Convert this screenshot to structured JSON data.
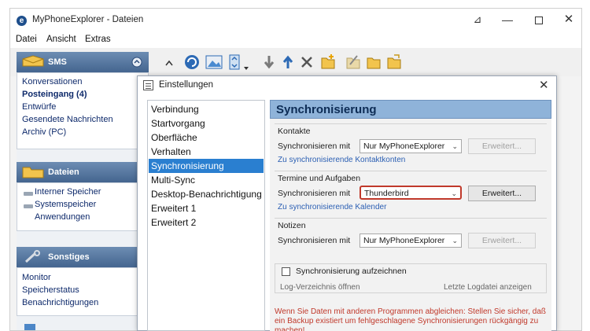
{
  "window": {
    "title": "MyPhoneExplorer - Dateien",
    "controls": {
      "pin": "⊿",
      "minimize": "—",
      "close": "✕"
    }
  },
  "menubar": [
    "Datei",
    "Ansicht",
    "Extras"
  ],
  "sidebar": {
    "sms": {
      "header": "SMS",
      "items": [
        "Konversationen",
        "Posteingang (4)",
        "Entwürfe",
        "Gesendete Nachrichten",
        "Archiv (PC)"
      ]
    },
    "dateien": {
      "header": "Dateien",
      "items": [
        "Interner Speicher",
        "Systemspeicher",
        "Anwendungen"
      ]
    },
    "sonstiges": {
      "header": "Sonstiges",
      "items": [
        "Monitor",
        "Speicherstatus",
        "Benachrichtigungen"
      ]
    }
  },
  "dialog": {
    "title": "Einstellungen",
    "close": "✕",
    "nav": [
      "Verbindung",
      "Startvorgang",
      "Oberfläche",
      "Verhalten",
      "Synchronisierung",
      "Multi-Sync",
      "Desktop-Benachrichtigung",
      "Erweitert 1",
      "Erweitert 2"
    ],
    "selected_index": 4,
    "content": {
      "title": "Synchronisierung",
      "kontakte": {
        "title": "Kontakte",
        "label": "Synchronisieren mit",
        "value": "Nur MyPhoneExplorer",
        "button": "Erweitert...",
        "link": "Zu synchronisierende Kontaktkonten"
      },
      "termine": {
        "title": "Termine und Aufgaben",
        "label": "Synchronisieren mit",
        "value": "Thunderbird",
        "button": "Erweitert...",
        "link": "Zu synchronisierende Kalender"
      },
      "notizen": {
        "title": "Notizen",
        "label": "Synchronisieren mit",
        "value": "Nur MyPhoneExplorer",
        "button": "Erweitert..."
      },
      "log": {
        "checkbox_label": "Synchronisierung aufzeichnen",
        "open_dir": "Log-Verzeichnis öffnen",
        "last_log": "Letzte Logdatei anzeigen"
      },
      "warning": "Wenn Sie Daten mit anderen Programmen abgleichen: Stellen Sie sicher, daß ein Backup existiert um fehlgeschlagene Synchronisierungen rückgängig zu machen!"
    }
  },
  "colors": {
    "selected": "#2a7fd0",
    "header": "#8fb3d9",
    "highlight": "#c0392b",
    "link": "#2b5fb3"
  }
}
